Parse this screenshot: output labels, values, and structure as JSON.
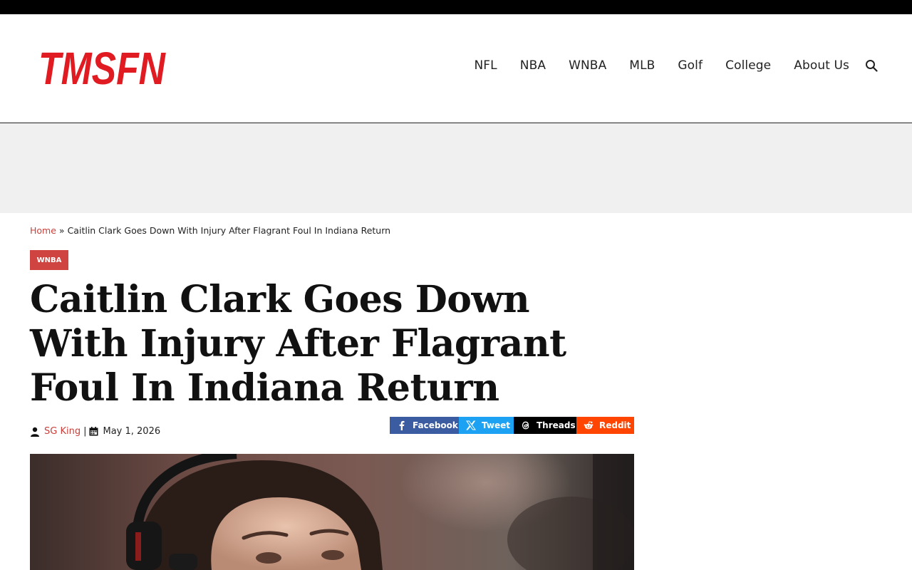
{
  "site": {
    "logo_text": "TMSFN",
    "brand_color": "#e01b22"
  },
  "nav": {
    "items": [
      "NFL",
      "NBA",
      "WNBA",
      "MLB",
      "Golf",
      "College",
      "About Us"
    ],
    "search_icon": "search-icon"
  },
  "breadcrumb": {
    "home": "Home",
    "separator": "»",
    "current": "Caitlin Clark Goes Down With Injury After Flagrant Foul In Indiana Return"
  },
  "article": {
    "category": "WNBA",
    "title": "Caitlin Clark Goes Down With Injury After Flagrant Foul In Indiana Return",
    "author": "SG King",
    "meta_separator": "|",
    "date": "May 1, 2026"
  },
  "share": {
    "facebook": "Facebook",
    "tweet": "Tweet",
    "threads": "Threads",
    "reddit": "Reddit"
  },
  "colors": {
    "accent": "#cf4440",
    "facebook": "#3b5ca0",
    "twitter": "#1da1f2",
    "threads": "#000000",
    "reddit": "#ff4500"
  }
}
